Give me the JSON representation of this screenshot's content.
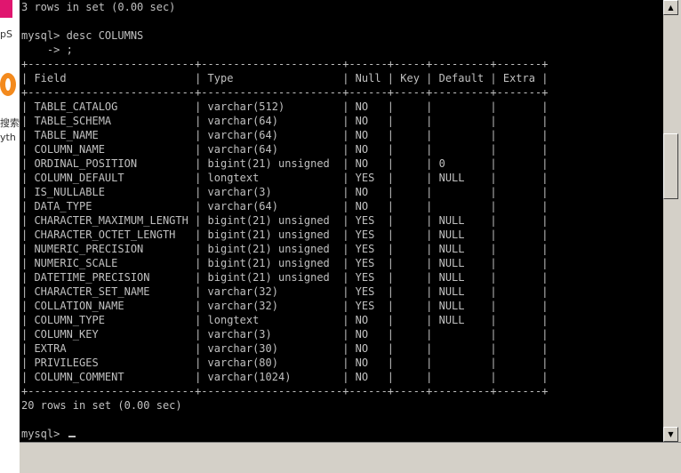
{
  "background": {
    "fragments": [
      "pS",
      "搜索",
      "yth"
    ]
  },
  "console": {
    "lines": [
      "3 rows in set (0.00 sec)",
      "",
      "mysql> desc COLUMNS",
      "    -> ;",
      "+--------------------------+----------------------+------+-----+---------+-------+",
      "| Field                    | Type                 | Null | Key | Default | Extra |",
      "+--------------------------+----------------------+------+-----+---------+-------+",
      "| TABLE_CATALOG            | varchar(512)         | NO   |     |         |       |",
      "| TABLE_SCHEMA             | varchar(64)          | NO   |     |         |       |",
      "| TABLE_NAME               | varchar(64)          | NO   |     |         |       |",
      "| COLUMN_NAME              | varchar(64)          | NO   |     |         |       |",
      "| ORDINAL_POSITION         | bigint(21) unsigned  | NO   |     | 0       |       |",
      "| COLUMN_DEFAULT           | longtext             | YES  |     | NULL    |       |",
      "| IS_NULLABLE              | varchar(3)           | NO   |     |         |       |",
      "| DATA_TYPE                | varchar(64)          | NO   |     |         |       |",
      "| CHARACTER_MAXIMUM_LENGTH | bigint(21) unsigned  | YES  |     | NULL    |       |",
      "| CHARACTER_OCTET_LENGTH   | bigint(21) unsigned  | YES  |     | NULL    |       |",
      "| NUMERIC_PRECISION        | bigint(21) unsigned  | YES  |     | NULL    |       |",
      "| NUMERIC_SCALE            | bigint(21) unsigned  | YES  |     | NULL    |       |",
      "| DATETIME_PRECISION       | bigint(21) unsigned  | YES  |     | NULL    |       |",
      "| CHARACTER_SET_NAME       | varchar(32)          | YES  |     | NULL    |       |",
      "| COLLATION_NAME           | varchar(32)          | YES  |     | NULL    |       |",
      "| COLUMN_TYPE              | longtext             | NO   |     | NULL    |       |",
      "| COLUMN_KEY               | varchar(3)           | NO   |     |         |       |",
      "| EXTRA                    | varchar(30)          | NO   |     |         |       |",
      "| PRIVILEGES               | varchar(80)          | NO   |     |         |       |",
      "| COLUMN_COMMENT           | varchar(1024)        | NO   |     |         |       |",
      "+--------------------------+----------------------+------+-----+---------+-------+",
      "20 rows in set (0.00 sec)",
      "",
      "mysql> "
    ]
  },
  "scrollbar": {
    "up_icon": "▲",
    "down_icon": "▼"
  }
}
